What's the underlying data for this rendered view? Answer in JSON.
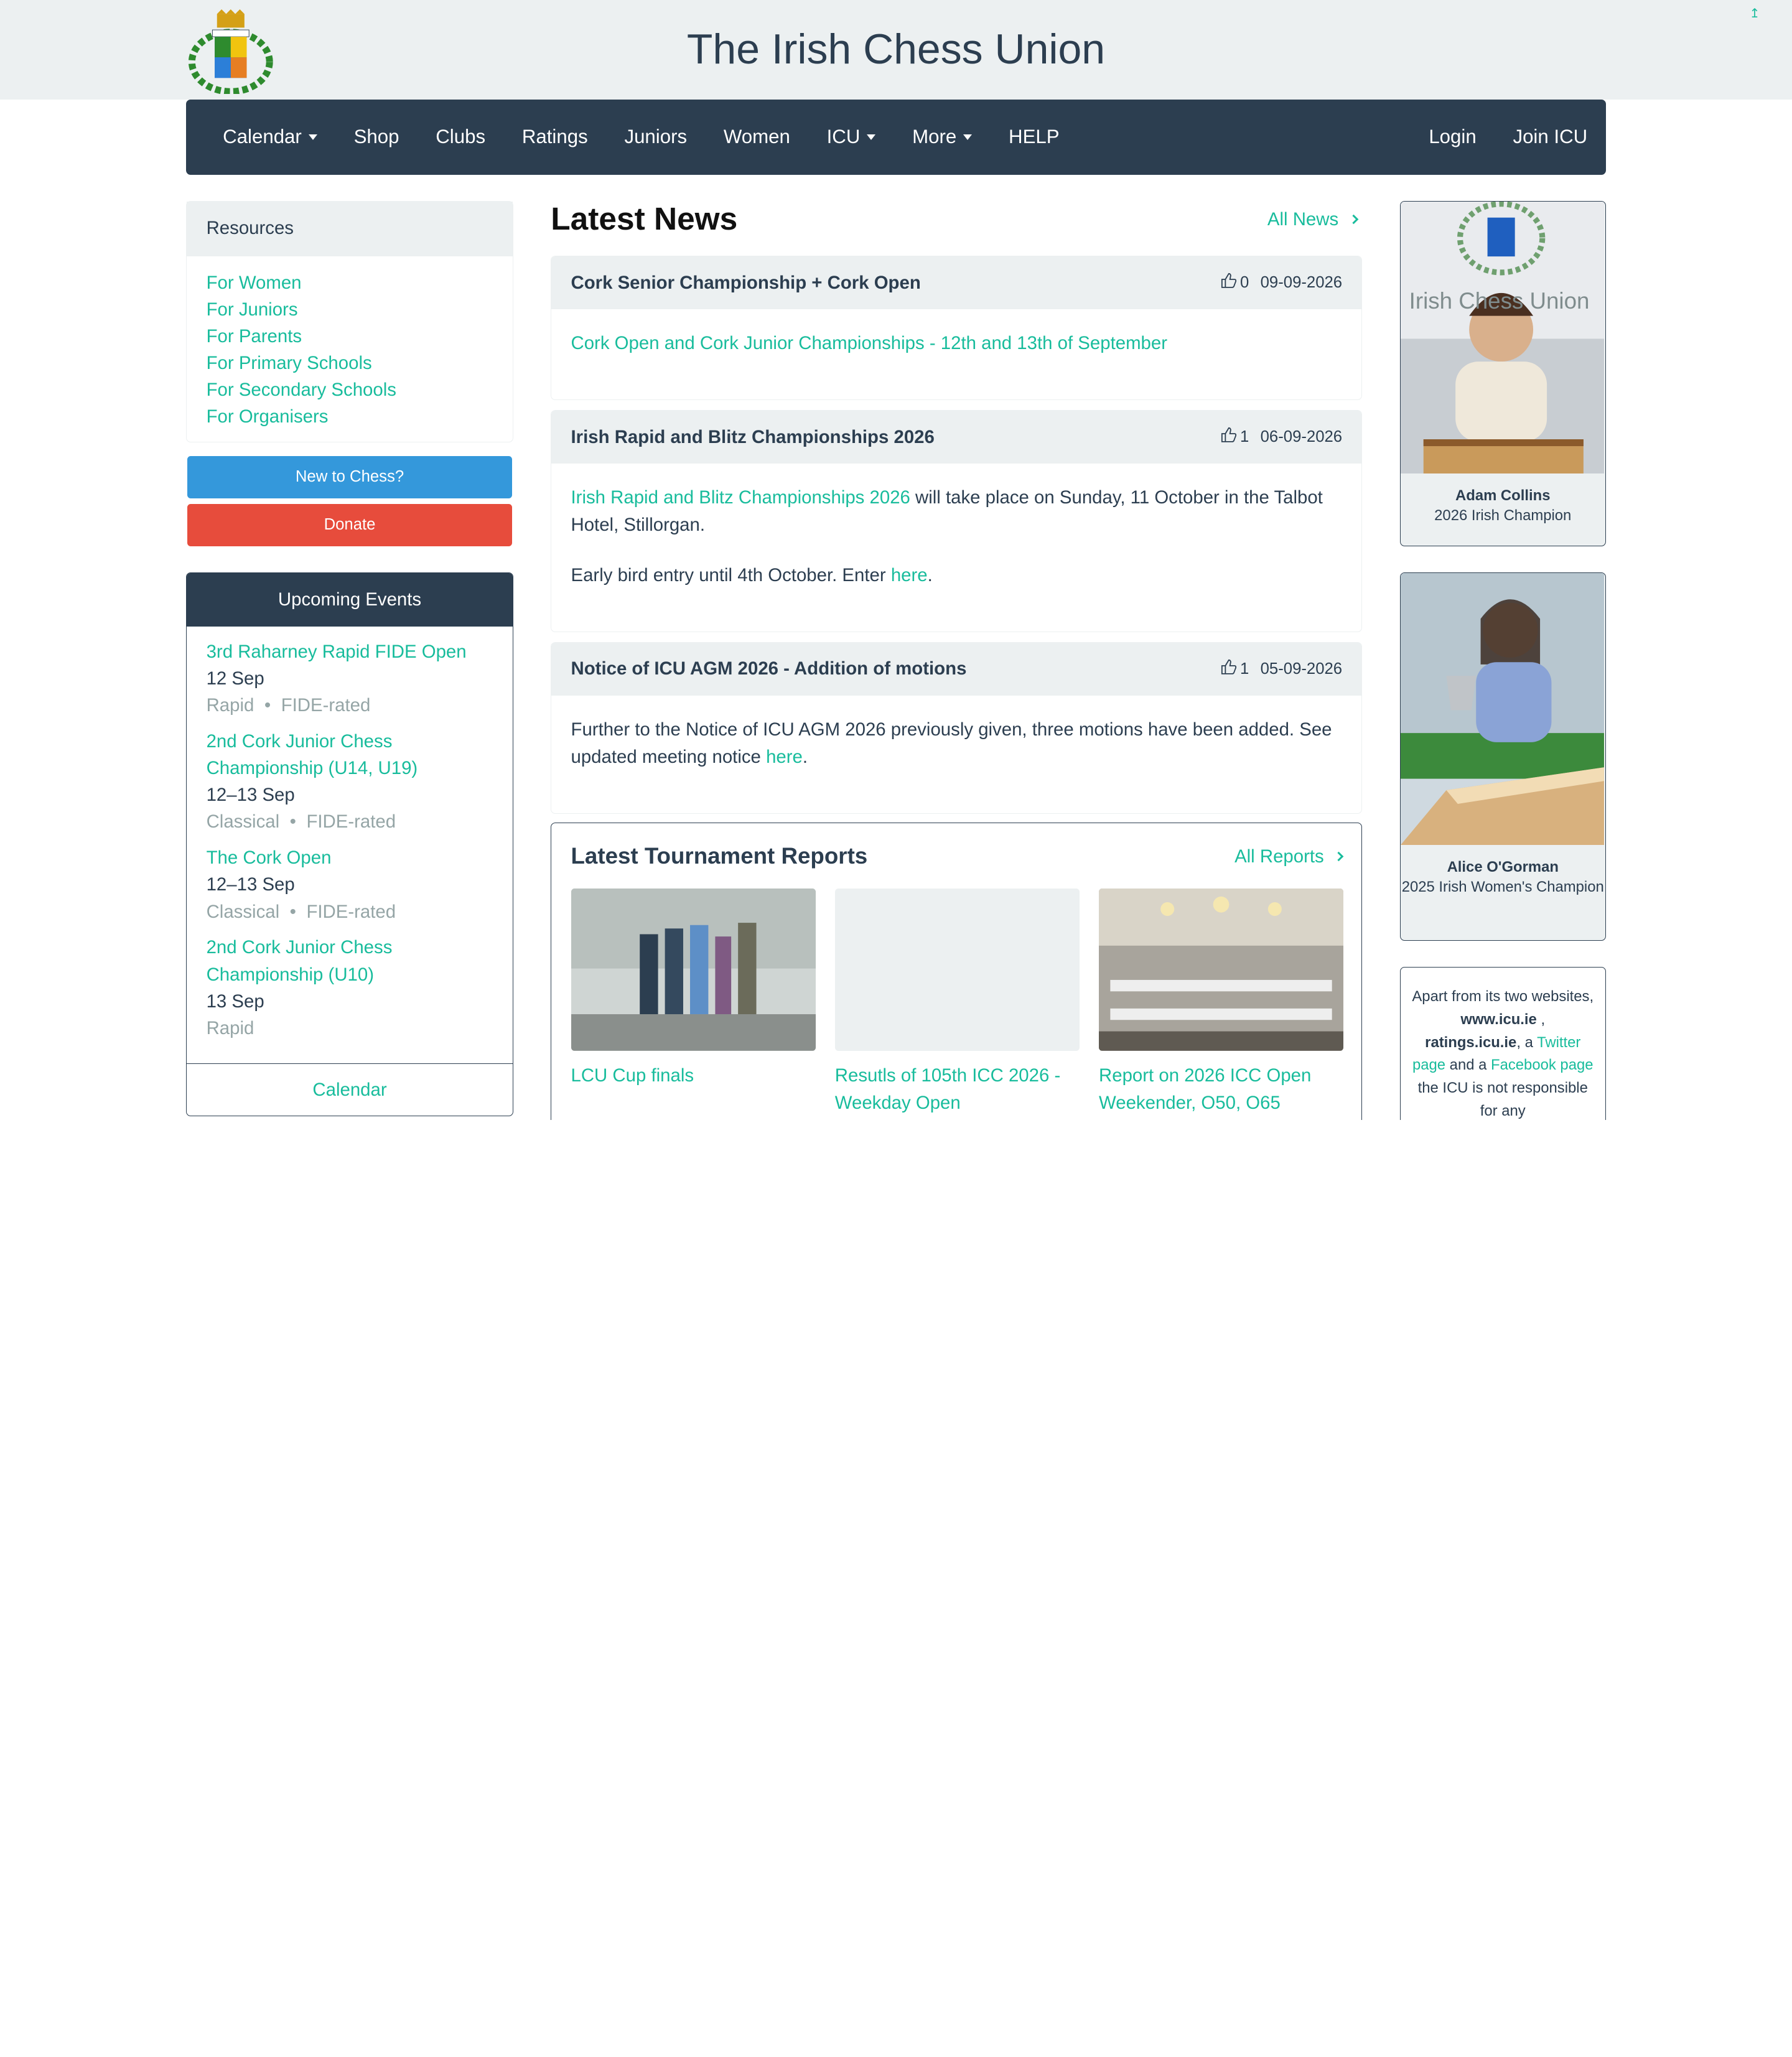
{
  "header": {
    "title": "The Irish Chess Union",
    "logo_text": "Irish Chess Union",
    "scroll_icon": "↥"
  },
  "nav": {
    "left": [
      "Calendar",
      "Shop",
      "Clubs",
      "Ratings",
      "Juniors",
      "Women",
      "ICU",
      "More",
      "HELP"
    ],
    "right": [
      "Login",
      "Join ICU"
    ]
  },
  "resources": {
    "heading": "Resources",
    "links": [
      "For Women",
      "For Juniors",
      "For Parents",
      "For Primary Schools",
      "For Secondary Schools",
      "For Organisers"
    ]
  },
  "buttons": {
    "new_to_chess": "New to Chess?",
    "donate": "Donate"
  },
  "events": {
    "heading": "Upcoming Events",
    "items": [
      {
        "title": "3rd Raharney Rapid FIDE Open",
        "date": "12 Sep",
        "type": "Rapid",
        "rating": "FIDE-rated"
      },
      {
        "title": "2nd Cork Junior Chess Championship (U14, U19)",
        "date": "12–13 Sep",
        "type": "Classical",
        "rating": "FIDE-rated"
      },
      {
        "title": "The Cork Open",
        "date": "12–13 Sep",
        "type": "Classical",
        "rating": "FIDE-rated"
      },
      {
        "title": "2nd Cork Junior Chess Championship (U10)",
        "date": "13 Sep",
        "type": "Rapid",
        "rating": ""
      }
    ],
    "footer": "Calendar"
  },
  "news": {
    "heading": "Latest News",
    "all_link": "All News",
    "items": [
      {
        "title": "Cork Senior Championship + Cork Open",
        "likes": "0",
        "date": "09-09-2026",
        "link": "Cork Open and Cork Junior Championships - 12th and 13th of September"
      },
      {
        "title": "Irish Rapid and Blitz Championships 2026",
        "likes": "1",
        "date": "06-09-2026",
        "link": "Irish Rapid and Blitz Championships 2026",
        "text": " will take place on Sunday, 11 October in the Talbot Hotel, Stillorgan.",
        "para2": "Early bird entry until 4th October. Enter ",
        "para2_link": "here",
        "para2_end": "."
      },
      {
        "title": "Notice of ICU AGM 2026 - Addition of motions",
        "likes": "1",
        "date": "05-09-2026",
        "text": "Further to the Notice of ICU AGM 2026 previously given, three motions have been added. See updated meeting notice ",
        "link": "here",
        "end": "."
      }
    ]
  },
  "reports": {
    "heading": "Latest Tournament Reports",
    "all_link": "All Reports",
    "items": [
      {
        "caption": "LCU Cup finals"
      },
      {
        "caption": "Resutls of 105th ICC 2026 - Weekday Open"
      },
      {
        "caption": "Report on 2026 ICC Open Weekender, O50, O65"
      }
    ]
  },
  "champions": [
    {
      "name": "Adam Collins",
      "desc": "2026 Irish Champion",
      "banner": "Irish Chess Union"
    },
    {
      "name": "Alice O'Gorman",
      "desc": "2025 Irish Women's Champion"
    }
  ],
  "info": {
    "t1": "Apart from its two websites, ",
    "b1": "www.icu.ie",
    "t2": " , ",
    "b2": "ratings.icu.ie",
    "t3": ", a ",
    "l1": "Twitter page",
    "t4": " and a ",
    "l2": "Facebook page",
    "t5": " the ICU is not responsible for any"
  },
  "colors": {
    "primary": "#2c3e50",
    "accent": "#18bc9c",
    "info": "#3498db",
    "danger": "#e74c3c",
    "light": "#ecf0f1",
    "muted": "#95a5a6"
  }
}
